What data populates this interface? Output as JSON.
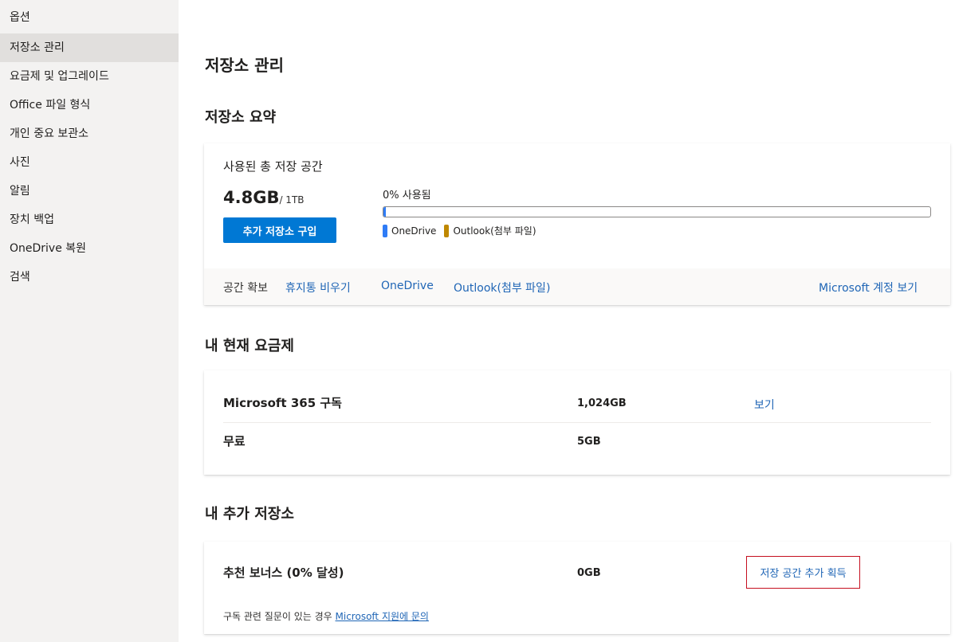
{
  "sidebar": {
    "title": "옵션",
    "items": [
      {
        "label": "저장소 관리",
        "active": true
      },
      {
        "label": "요금제 및 업그레이드"
      },
      {
        "label": "Office 파일 형식"
      },
      {
        "label": "개인 중요 보관소"
      },
      {
        "label": "사진"
      },
      {
        "label": "알림"
      },
      {
        "label": "장치 백업"
      },
      {
        "label": "OneDrive 복원"
      },
      {
        "label": "검색"
      }
    ]
  },
  "main": {
    "title": "저장소 관리",
    "summary": {
      "heading": "저장소 요약",
      "total_label": "사용된 총 저장 공간",
      "used_amount": "4.8GB",
      "total_amount": "/ 1TB",
      "buy_button": "추가 저장소 구입",
      "percent_label": "0% 사용됨",
      "usage_fraction": 0.004,
      "legend": [
        {
          "label": "OneDrive",
          "color": "#2f7cf6"
        },
        {
          "label": "Outlook(첨부 파일)",
          "color": "#bf8800"
        }
      ],
      "footer": {
        "label": "공간 확보",
        "links": [
          "휴지통 비우기",
          "OneDrive",
          "Outlook(첨부 파일)"
        ],
        "account_link": "Microsoft 계정 보기"
      }
    },
    "plan": {
      "heading": "내 현재 요금제",
      "rows": [
        {
          "name": "Microsoft 365 구독",
          "size": "1,024GB",
          "link": "보기"
        },
        {
          "name": "무료",
          "size": "5GB"
        }
      ]
    },
    "extra": {
      "heading": "내 추가 저장소",
      "bonus_name": "추천 보너스 (0% 달성)",
      "bonus_size": "0GB",
      "get_more_button": "저장 공간 추가 획득",
      "support_prefix": "구독 관련 질문이 있는 경우 ",
      "support_link": "Microsoft 지원에 문의"
    }
  }
}
